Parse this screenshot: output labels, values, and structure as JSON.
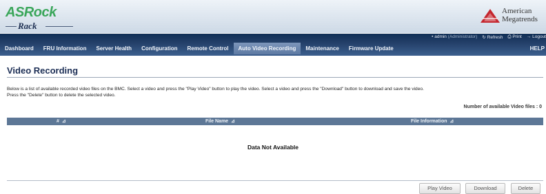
{
  "header": {
    "logo_main": "ASRock",
    "logo_sub": "Rack",
    "vendor_line1": "American",
    "vendor_line2": "Megatrends",
    "brand_green": "#3aa65a",
    "vendor_red": "#c4262e"
  },
  "utility": {
    "user": "admin",
    "role": "(Administrator)",
    "refresh": "Refresh",
    "print": "Print",
    "logout": "Logout"
  },
  "nav": {
    "tabs": [
      {
        "label": "Dashboard"
      },
      {
        "label": "FRU Information"
      },
      {
        "label": "Server Health"
      },
      {
        "label": "Configuration"
      },
      {
        "label": "Remote Control"
      },
      {
        "label": "Auto Video Recording"
      },
      {
        "label": "Maintenance"
      },
      {
        "label": "Firmware Update"
      },
      {
        "label": "HELP"
      }
    ],
    "active": "Auto Video Recording"
  },
  "page": {
    "title": "Video Recording",
    "description_line1": "Below is a list of available recorded video files on the BMC. Select a video and press the \"Play Video\" button to play the video. Select a video and press the \"Download\" button to download and save the video.",
    "description_line2": "Press the \"Delete\" button to delete the selected video.",
    "count_label": "Number of available Video files : 0"
  },
  "table": {
    "columns": [
      "#",
      "File Name",
      "File Information"
    ],
    "empty_text": "Data Not Available"
  },
  "buttons": {
    "play": "Play Video",
    "download": "Download",
    "delete": "Delete"
  }
}
